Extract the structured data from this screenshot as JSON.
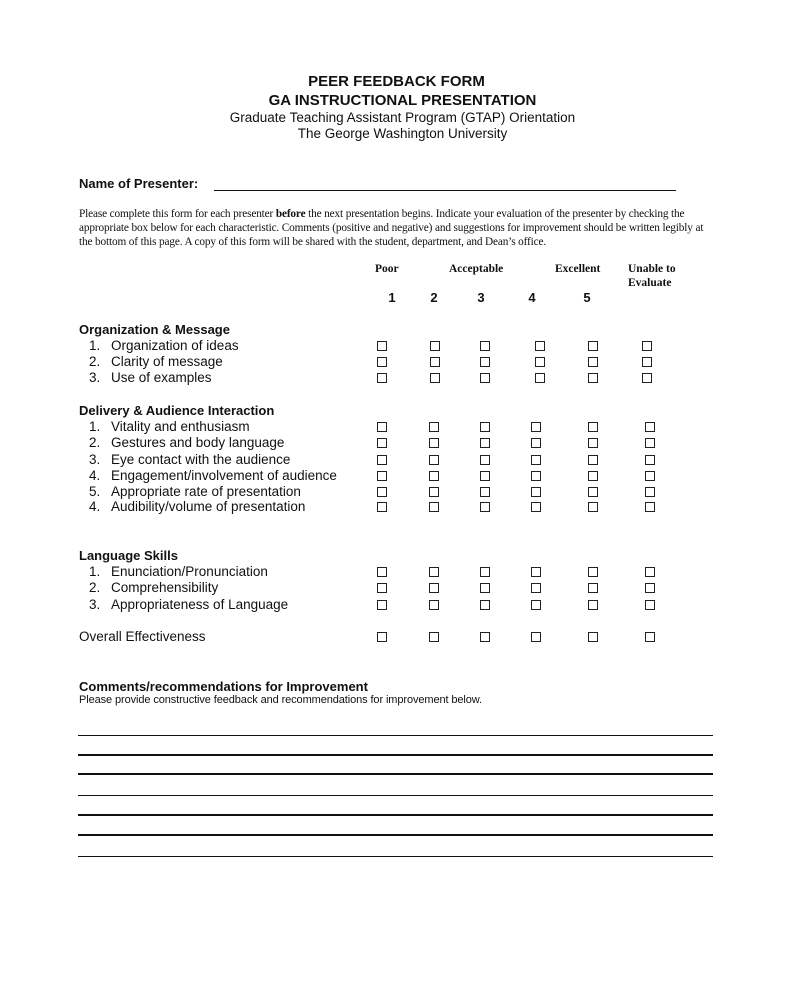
{
  "header": {
    "title": "PEER FEEDBACK FORM",
    "subtitle": "GA INSTRUCTIONAL PRESENTATION",
    "program": "Graduate Teaching Assistant Program (GTAP) Orientation",
    "university": "The George Washington University"
  },
  "presenter": {
    "label": "Name of Presenter:",
    "value": ""
  },
  "instructions": {
    "part1": "Please complete this form for each presenter ",
    "bold": "before",
    "part2": " the next presentation begins. Indicate your evaluation of the presenter by checking the appropriate box below for each characteristic. Comments (positive and negative) and suggestions for improvement should be written legibly at the bottom of this page. A copy of this form will be shared with the student, department, and Dean’s office."
  },
  "scale": {
    "labels": {
      "poor": "Poor",
      "acceptable": "Acceptable",
      "excellent": "Excellent",
      "unable_line1": "Unable to",
      "unable_line2": "Evaluate"
    },
    "numbers": [
      "1",
      "2",
      "3",
      "4",
      "5"
    ]
  },
  "sections": [
    {
      "title": "Organization & Message",
      "items": [
        {
          "num": "1.",
          "label": "Organization of ideas"
        },
        {
          "num": "2.",
          "label": "Clarity of message"
        },
        {
          "num": "3.",
          "label": "Use of examples"
        }
      ]
    },
    {
      "title": "Delivery & Audience Interaction",
      "items": [
        {
          "num": "1.",
          "label": "Vitality and enthusiasm"
        },
        {
          "num": "2.",
          "label": "Gestures and body language"
        },
        {
          "num": "3.",
          "label": "Eye contact with the audience"
        },
        {
          "num": "4.",
          "label": "Engagement/involvement of audience"
        },
        {
          "num": "5.",
          "label": "Appropriate rate of presentation"
        },
        {
          "num": "4.",
          "label": "Audibility/volume of presentation"
        }
      ]
    },
    {
      "title": "Language Skills",
      "items": [
        {
          "num": "1.",
          "label": "Enunciation/Pronunciation"
        },
        {
          "num": "2.",
          "label": "Comprehensibility"
        },
        {
          "num": "3.",
          "label": "Appropriateness of Language"
        }
      ]
    }
  ],
  "overall": {
    "label": "Overall Effectiveness"
  },
  "rating_options": [
    "1",
    "2",
    "3",
    "4",
    "5",
    "Unable to Evaluate"
  ],
  "comments": {
    "title": "Comments/recommendations for Improvement",
    "subtitle": "Please provide constructive feedback and recommendations for improvement below.",
    "line_count": 7
  }
}
